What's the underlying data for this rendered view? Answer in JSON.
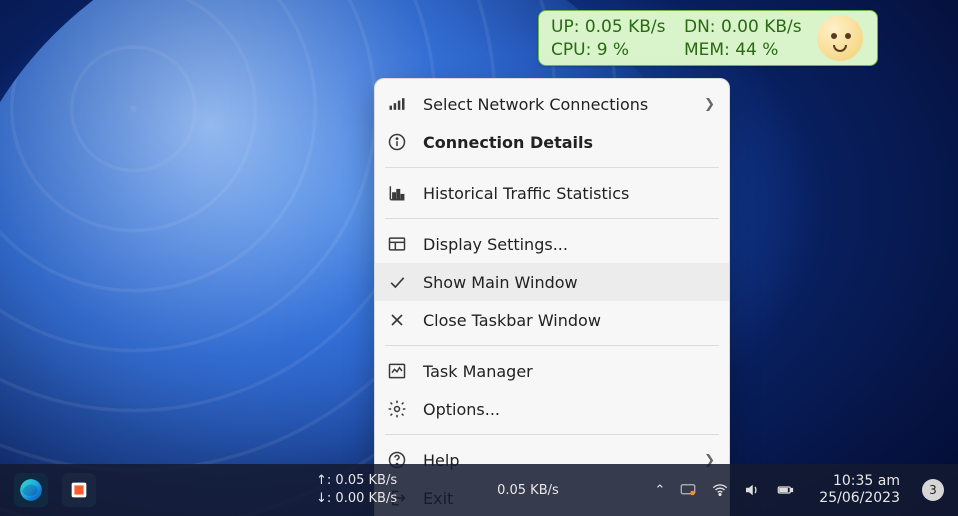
{
  "widget": {
    "up_label": "UP:",
    "up_value": "0.05 KB/s",
    "dn_label": "DN:",
    "dn_value": "0.00 KB/s",
    "cpu_label": "CPU:",
    "cpu_value": "9 %",
    "mem_label": "MEM:",
    "mem_value": "44 %"
  },
  "menu": {
    "select_connections": "Select Network Connections",
    "connection_details": "Connection Details",
    "historical": "Historical Traffic Statistics",
    "display_settings": "Display Settings...",
    "show_main_window": "Show Main Window",
    "close_taskbar_window": "Close Taskbar Window",
    "task_manager": "Task Manager",
    "options": "Options...",
    "help": "Help",
    "exit": "Exit"
  },
  "taskbar": {
    "up_arrow": "↑:",
    "up_rate": "0.05 KB/s",
    "down_arrow": "↓:",
    "down_rate": "0.00 KB/s",
    "combined_rate": "0.05 KB/s",
    "time": "10:35 am",
    "date": "25/06/2023",
    "notif_count": "3"
  }
}
